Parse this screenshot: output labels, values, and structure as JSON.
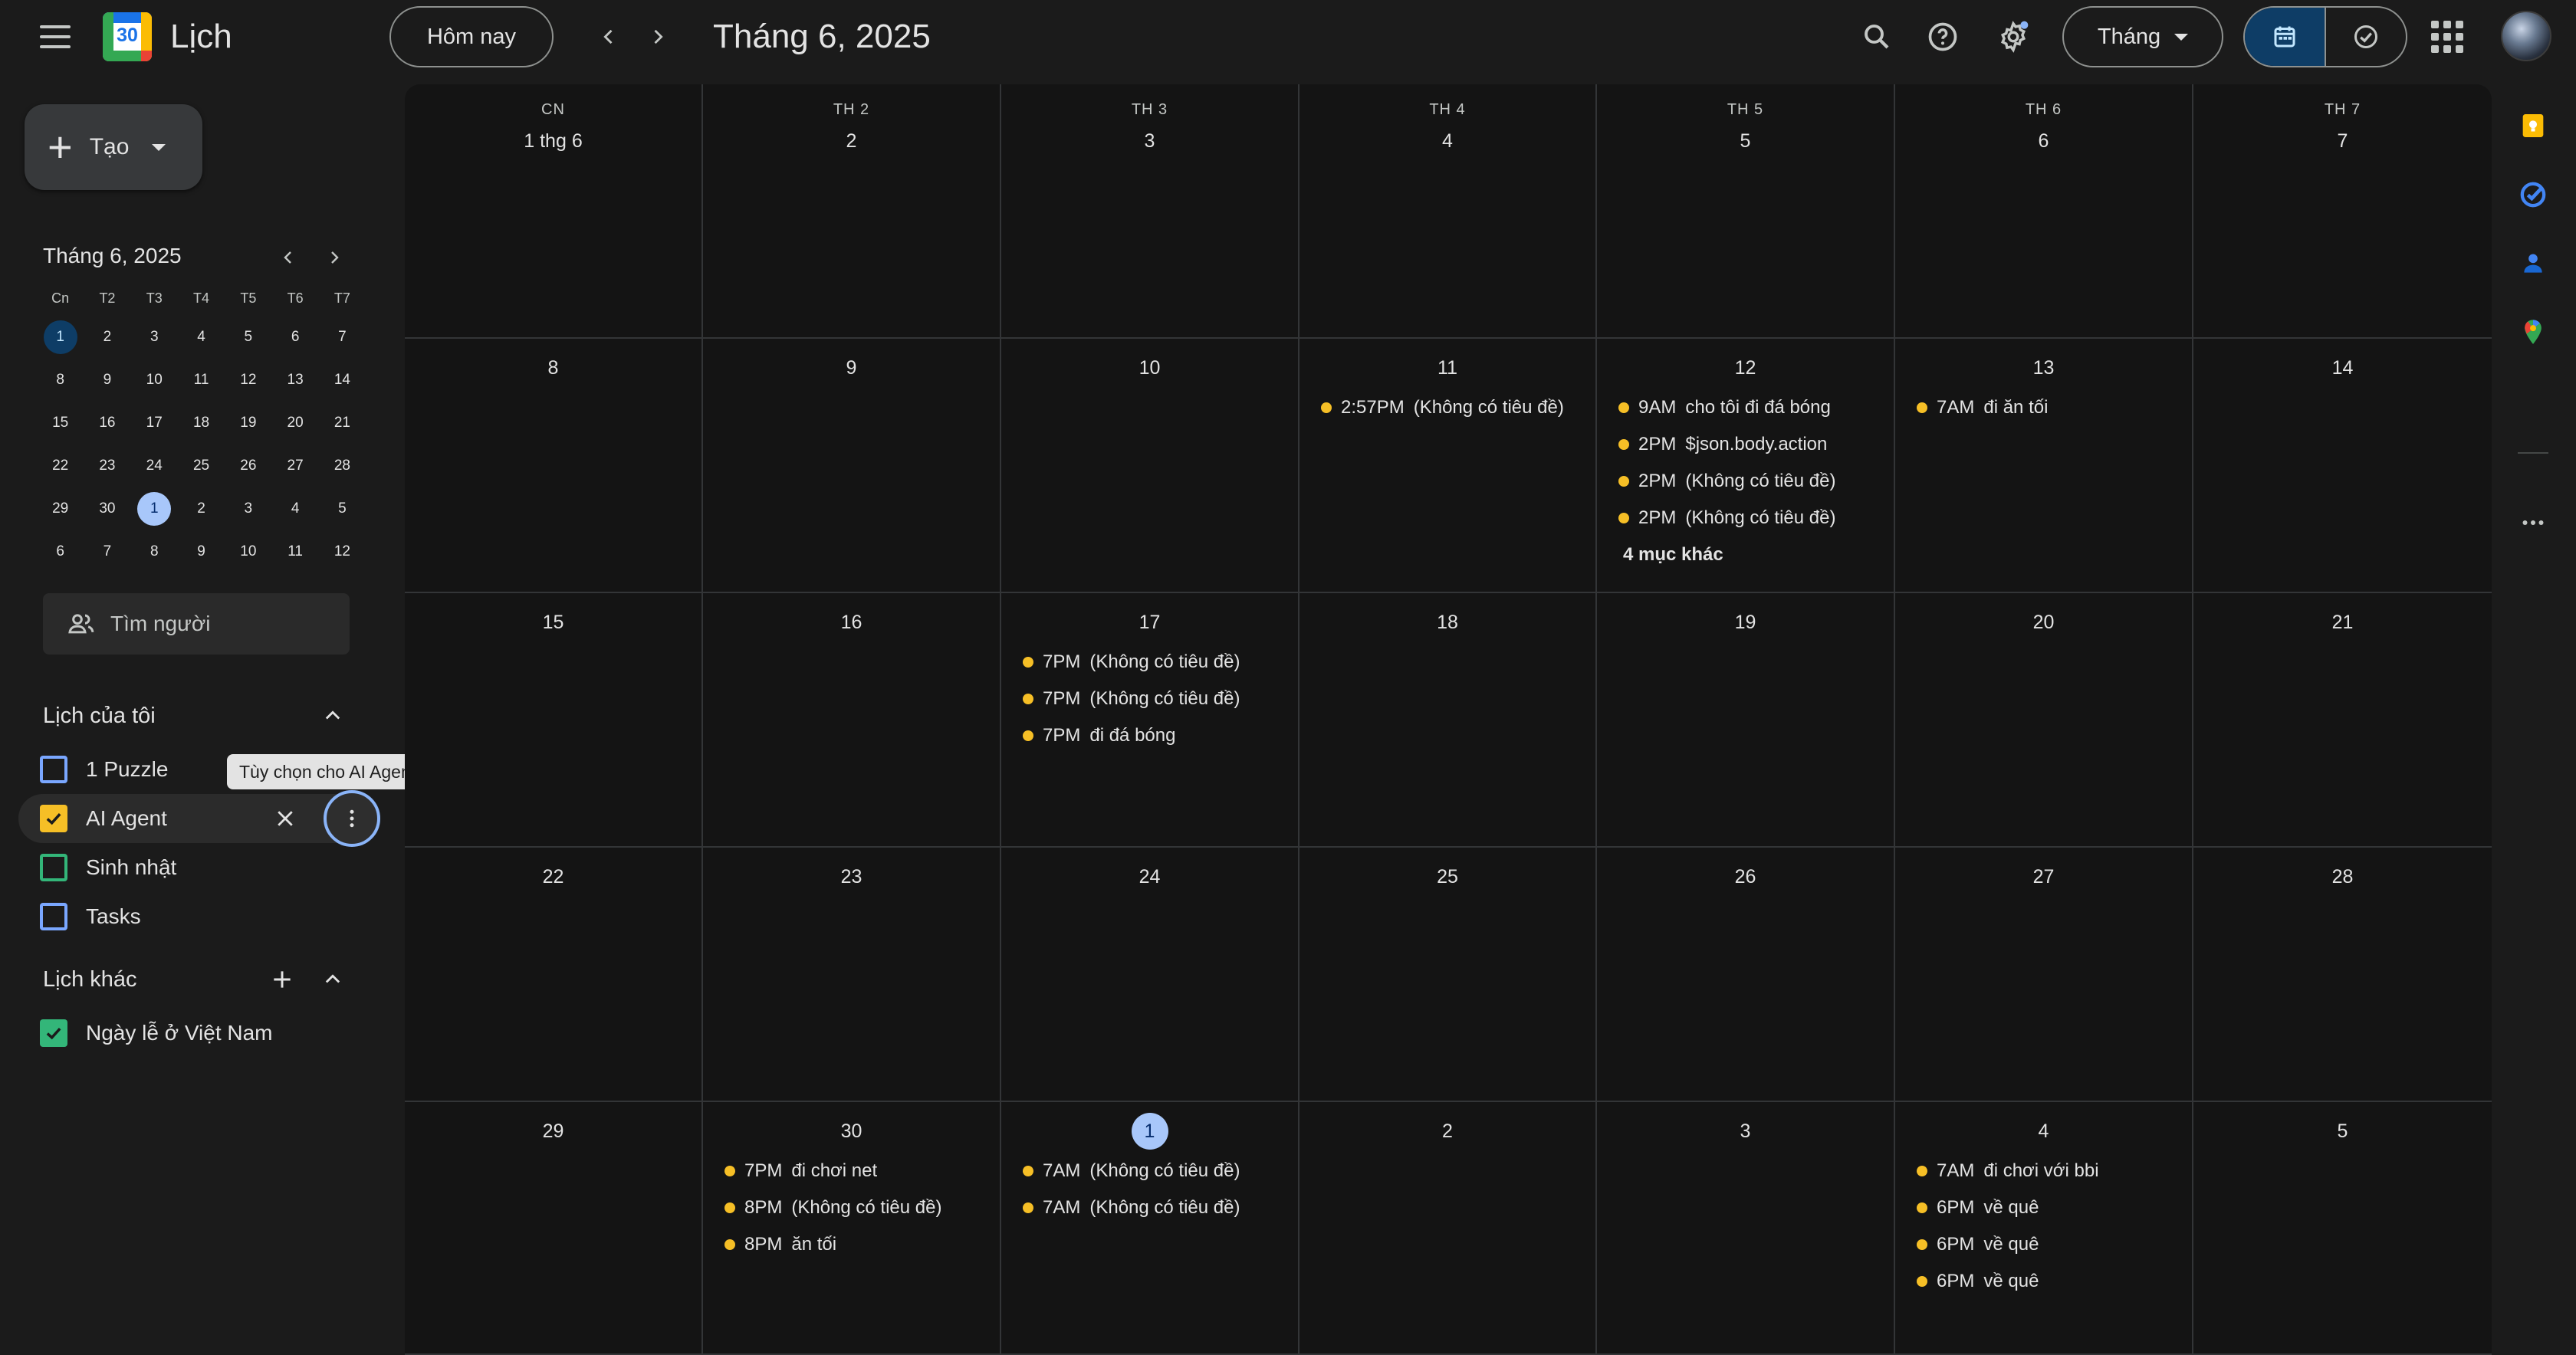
{
  "header": {
    "app_title": "Lịch",
    "logo_day": "30",
    "today_button": "Hôm nay",
    "period_title": "Tháng 6, 2025",
    "view_select": "Tháng"
  },
  "sidebar": {
    "create_button": "Tạo",
    "mini_calendar": {
      "title": "Tháng 6, 2025",
      "weekdays": [
        "Cn",
        "T2",
        "T3",
        "T4",
        "T5",
        "T6",
        "T7"
      ],
      "weeks": [
        [
          "1",
          "2",
          "3",
          "4",
          "5",
          "6",
          "7"
        ],
        [
          "8",
          "9",
          "10",
          "11",
          "12",
          "13",
          "14"
        ],
        [
          "15",
          "16",
          "17",
          "18",
          "19",
          "20",
          "21"
        ],
        [
          "22",
          "23",
          "24",
          "25",
          "26",
          "27",
          "28"
        ],
        [
          "29",
          "30",
          "1",
          "2",
          "3",
          "4",
          "5"
        ],
        [
          "6",
          "7",
          "8",
          "9",
          "10",
          "11",
          "12"
        ]
      ],
      "selected": "1",
      "today": "1"
    },
    "people_search_placeholder": "Tìm người",
    "my_calendars_title": "Lịch của tôi",
    "my_calendars": [
      {
        "label": "1 Puzzle",
        "checked": false,
        "color": "#7aa7ff"
      },
      {
        "label": "AI Agent",
        "checked": true,
        "color": "#f6bf26"
      },
      {
        "label": "Sinh nhật",
        "checked": false,
        "color": "#33b679"
      },
      {
        "label": "Tasks",
        "checked": false,
        "color": "#7aa7ff"
      }
    ],
    "other_calendars_title": "Lịch khác",
    "other_calendars": [
      {
        "label": "Ngày lễ ở Việt Nam",
        "checked": true,
        "color": "#33b679"
      }
    ],
    "tooltip": "Tùy chọn cho AI Agent"
  },
  "grid": {
    "weekdays": [
      "CN",
      "TH 2",
      "TH 3",
      "TH 4",
      "TH 5",
      "TH 6",
      "TH 7"
    ],
    "weeks": [
      [
        {
          "day": "1 thg 6",
          "events": []
        },
        {
          "day": "2",
          "events": []
        },
        {
          "day": "3",
          "events": []
        },
        {
          "day": "4",
          "events": []
        },
        {
          "day": "5",
          "events": []
        },
        {
          "day": "6",
          "events": []
        },
        {
          "day": "7",
          "events": []
        }
      ],
      [
        {
          "day": "8",
          "events": []
        },
        {
          "day": "9",
          "events": []
        },
        {
          "day": "10",
          "events": []
        },
        {
          "day": "11",
          "events": [
            {
              "time": "2:57PM",
              "title": "(Không có tiêu đề)"
            }
          ]
        },
        {
          "day": "12",
          "events": [
            {
              "time": "9AM",
              "title": "cho tôi đi đá bóng"
            },
            {
              "time": "2PM",
              "title": "$json.body.action"
            },
            {
              "time": "2PM",
              "title": "(Không có tiêu đề)"
            },
            {
              "time": "2PM",
              "title": "(Không có tiêu đề)"
            }
          ],
          "more": "4 mục khác"
        },
        {
          "day": "13",
          "events": [
            {
              "time": "7AM",
              "title": "đi ăn tối"
            }
          ]
        },
        {
          "day": "14",
          "events": []
        }
      ],
      [
        {
          "day": "15",
          "events": []
        },
        {
          "day": "16",
          "events": []
        },
        {
          "day": "17",
          "events": [
            {
              "time": "7PM",
              "title": "(Không có tiêu đề)"
            },
            {
              "time": "7PM",
              "title": "(Không có tiêu đề)"
            },
            {
              "time": "7PM",
              "title": "đi đá bóng"
            }
          ]
        },
        {
          "day": "18",
          "events": []
        },
        {
          "day": "19",
          "events": []
        },
        {
          "day": "20",
          "events": []
        },
        {
          "day": "21",
          "events": []
        }
      ],
      [
        {
          "day": "22",
          "events": []
        },
        {
          "day": "23",
          "events": []
        },
        {
          "day": "24",
          "events": []
        },
        {
          "day": "25",
          "events": []
        },
        {
          "day": "26",
          "events": []
        },
        {
          "day": "27",
          "events": []
        },
        {
          "day": "28",
          "events": []
        }
      ],
      [
        {
          "day": "29",
          "events": []
        },
        {
          "day": "30",
          "events": [
            {
              "time": "7PM",
              "title": "đi chơi net"
            },
            {
              "time": "8PM",
              "title": "(Không có tiêu đề)"
            },
            {
              "time": "8PM",
              "title": "ăn tối"
            }
          ]
        },
        {
          "day": "1",
          "today": true,
          "events": [
            {
              "time": "7AM",
              "title": "(Không có tiêu đề)"
            },
            {
              "time": "7AM",
              "title": "(Không có tiêu đề)"
            }
          ]
        },
        {
          "day": "2",
          "events": []
        },
        {
          "day": "3",
          "events": []
        },
        {
          "day": "4",
          "events": [
            {
              "time": "7AM",
              "title": "đi chơi với bbi"
            },
            {
              "time": "6PM",
              "title": "về quê"
            },
            {
              "time": "6PM",
              "title": "về quê"
            },
            {
              "time": "6PM",
              "title": "về quê"
            }
          ]
        },
        {
          "day": "5",
          "events": []
        }
      ]
    ]
  },
  "colors": {
    "accent": "#a8c7fa",
    "event_dot": "#f6bf26",
    "background": "#1b1b1b"
  },
  "side_panel_icons": [
    "keep-icon",
    "tasks-icon",
    "contacts-icon",
    "maps-icon",
    "more-icon"
  ]
}
